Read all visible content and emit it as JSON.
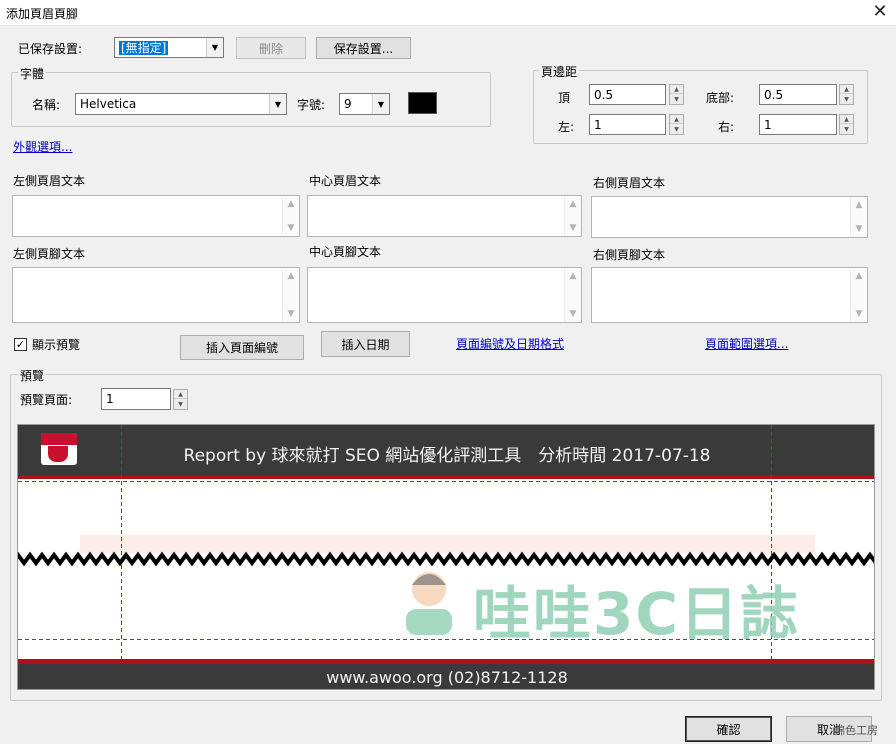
{
  "window": {
    "title": "添加頁眉頁腳",
    "close": "✕"
  },
  "saved": {
    "label": "已保存設置:",
    "value": "[無指定]",
    "delete_label": "刪除",
    "save_label": "保存設置..."
  },
  "font": {
    "group_label": "字體",
    "name_label": "名稱:",
    "name_value": "Helvetica",
    "size_label": "字號:",
    "size_value": "9",
    "color": "#000000"
  },
  "margins": {
    "group_label": "頁邊距",
    "top_label": "頂",
    "top_value": "0.5",
    "bottom_label": "底部:",
    "bottom_value": "0.5",
    "left_label": "左:",
    "left_value": "1",
    "right_label": "右:",
    "right_value": "1"
  },
  "appearance_link": "外觀選項...",
  "header": {
    "left_label": "左側頁眉文本",
    "center_label": "中心頁眉文本",
    "right_label": "右側頁眉文本"
  },
  "footer": {
    "left_label": "左側頁腳文本",
    "center_label": "中心頁腳文本",
    "right_label": "右側頁腳文本"
  },
  "controls": {
    "show_preview_label": "顯示預覽",
    "show_preview_checked": true,
    "insert_page_number": "插入頁面編號",
    "insert_date": "插入日期",
    "page_number_date_format_link": "頁面編號及日期格式",
    "page_range_link": "頁面範圍選項..."
  },
  "preview": {
    "group_label": "預覽",
    "page_label": "預覽頁面:",
    "page_value": "1",
    "header_text": "Report by 球來就打 SEO 網站優化評測工具　分析時間 2017-07-18",
    "footer_text": "www.awoo.org  (02)8712-1128",
    "watermark_text": "哇哇3C日誌"
  },
  "footer_buttons": {
    "ok": "確認",
    "cancel": "取消"
  },
  "corner_watermark": "錦色工房"
}
